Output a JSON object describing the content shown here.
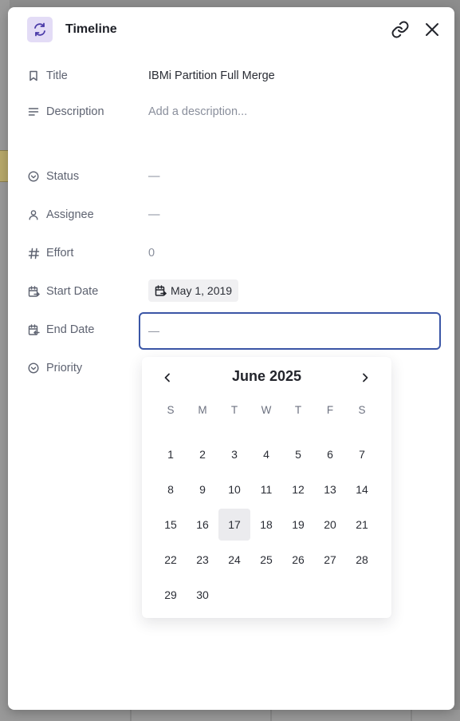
{
  "panel": {
    "title": "Timeline"
  },
  "icons": {
    "app": "refresh-cycle-icon",
    "link": "link-icon",
    "close": "close-icon"
  },
  "fields": {
    "title": {
      "label": "Title",
      "value": "IBMi Partition Full Merge"
    },
    "description": {
      "label": "Description",
      "placeholder": "Add a description..."
    },
    "status": {
      "label": "Status",
      "value": "—"
    },
    "assignee": {
      "label": "Assignee",
      "value": "—"
    },
    "effort": {
      "label": "Effort",
      "value": "0"
    },
    "start_date": {
      "label": "Start Date",
      "value": "May 1, 2019"
    },
    "end_date": {
      "label": "End Date",
      "value": "—"
    },
    "priority": {
      "label": "Priority"
    }
  },
  "calendar": {
    "month_label": "June 2025",
    "weekdays": [
      "S",
      "M",
      "T",
      "W",
      "T",
      "F",
      "S"
    ],
    "weeks": [
      [
        "1",
        "2",
        "3",
        "4",
        "5",
        "6",
        "7"
      ],
      [
        "8",
        "9",
        "10",
        "11",
        "12",
        "13",
        "14"
      ],
      [
        "15",
        "16",
        "17",
        "18",
        "19",
        "20",
        "21"
      ],
      [
        "22",
        "23",
        "24",
        "25",
        "26",
        "27",
        "28"
      ],
      [
        "29",
        "30",
        "",
        "",
        "",
        "",
        ""
      ]
    ],
    "highlighted_day": "17"
  },
  "colors": {
    "accent": "#3b56a6",
    "app_icon_bg": "#e3dcf6",
    "app_icon_fg": "#4a3aa8"
  }
}
